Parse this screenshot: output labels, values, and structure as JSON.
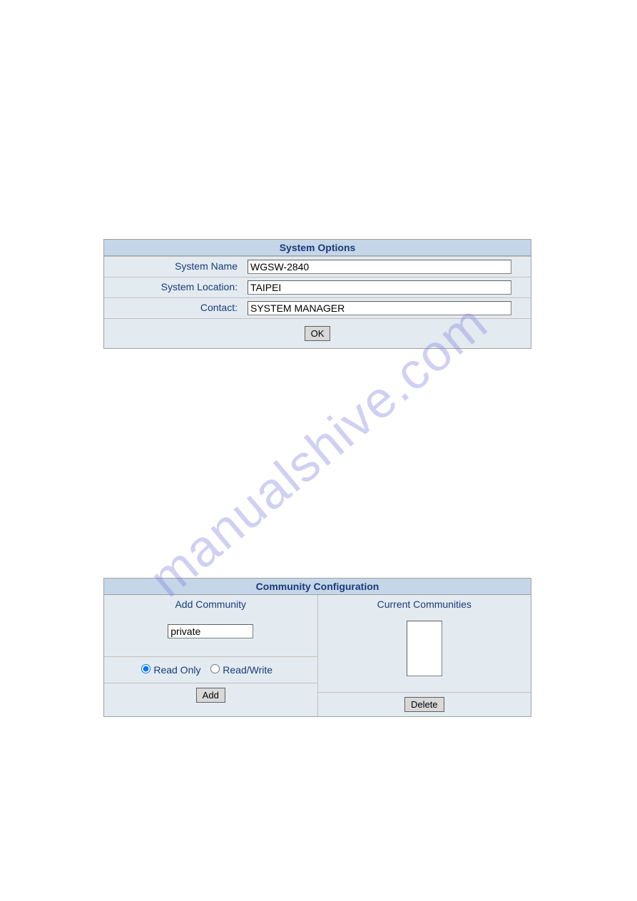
{
  "watermark": "manualshive.com",
  "systemOptions": {
    "title": "System Options",
    "fields": {
      "systemName": {
        "label": "System Name",
        "value": "WGSW-2840"
      },
      "systemLocation": {
        "label": "System Location:",
        "value": "TAIPEI"
      },
      "contact": {
        "label": "Contact:",
        "value": "SYSTEM MANAGER"
      }
    },
    "okButton": "OK"
  },
  "communityConfig": {
    "title": "Community Configuration",
    "addCommunity": {
      "header": "Add Community",
      "inputValue": "private",
      "radioReadOnly": "Read Only",
      "radioReadWrite": "Read/Write",
      "addButton": "Add"
    },
    "currentCommunities": {
      "header": "Current Communities",
      "deleteButton": "Delete"
    }
  }
}
